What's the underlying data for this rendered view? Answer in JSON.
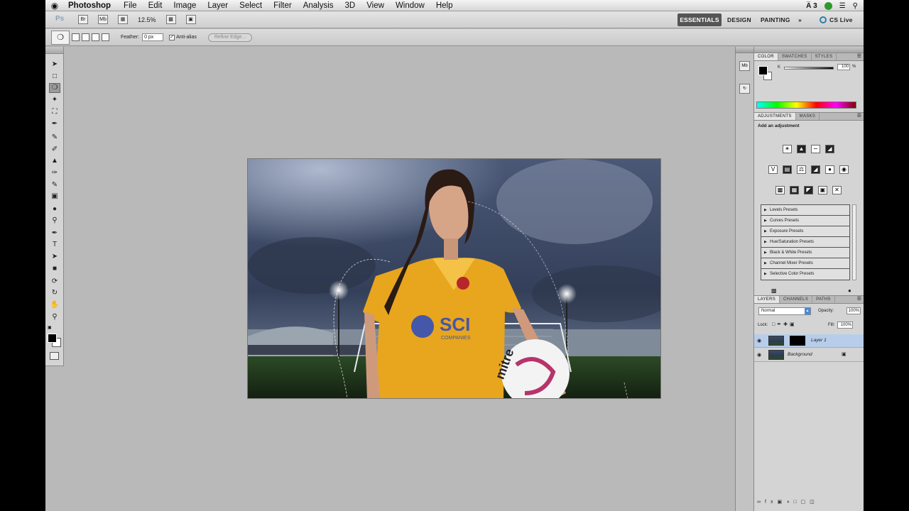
{
  "menubar": {
    "apple": "",
    "app_name": "Photoshop",
    "items": [
      "File",
      "Edit",
      "Image",
      "Layer",
      "Select",
      "Filter",
      "Analysis",
      "3D",
      "View",
      "Window",
      "Help"
    ],
    "status_ai": "A̅ 3"
  },
  "appbar": {
    "logo": "Ps",
    "zoom": "12.5%",
    "workspaces": {
      "essentials": "ESSENTIALS",
      "design": "DESIGN",
      "painting": "PAINTING",
      "more": "»",
      "cslive": "CS Live"
    }
  },
  "options": {
    "feather_label": "Feather:",
    "feather_value": "0 px",
    "antialias_label": "Anti-alias",
    "antialias_checked": "✓",
    "refine_edge": "Refine Edge..."
  },
  "panels": {
    "color": {
      "tabs": [
        "COLOR",
        "SWATCHES",
        "STYLES"
      ],
      "k_label": "K",
      "k_value": "100",
      "k_unit": "%"
    },
    "adjustments": {
      "tabs": [
        "ADJUSTMENTS",
        "MASKS"
      ],
      "title": "Add an adjustment",
      "presets": [
        "Levels Presets",
        "Curves Presets",
        "Exposure Presets",
        "Hue/Saturation Presets",
        "Black & White Presets",
        "Channel Mixer Presets",
        "Selective Color Presets"
      ]
    },
    "layers": {
      "tabs": [
        "LAYERS",
        "CHANNELS",
        "PATHS"
      ],
      "blend_mode": "Normal",
      "opacity_label": "Opacity:",
      "opacity_value": "100%",
      "lock_label": "Lock:",
      "fill_label": "Fill:",
      "fill_value": "100%",
      "layers": [
        {
          "name": "Layer 1",
          "selected": true
        },
        {
          "name": "Background",
          "selected": false
        }
      ]
    }
  },
  "canvas": {
    "jersey_text": "SCI",
    "jersey_sub": "COMPANIES",
    "ball_text": "mitre"
  },
  "colors": {
    "accent": "#4c8ad6",
    "selected_layer": "#b7cdea",
    "jersey": "#e8a51e"
  }
}
